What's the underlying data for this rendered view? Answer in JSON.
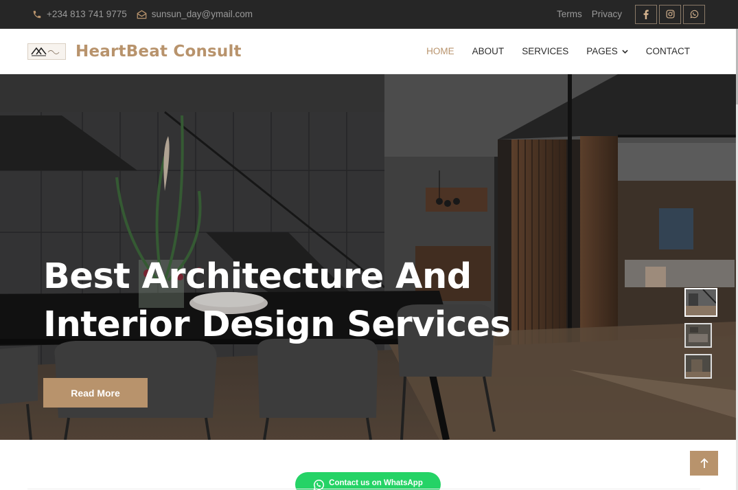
{
  "topbar": {
    "phone": "+234 813 741 9775",
    "email": "sunsun_day@ymail.com",
    "links": [
      "Terms",
      "Privacy"
    ],
    "socials": [
      "facebook-icon",
      "instagram-icon",
      "whatsapp-icon"
    ]
  },
  "navbar": {
    "brand": "HeartBeat Consult",
    "menu": [
      "HOME",
      "ABOUT",
      "SERVICES",
      "PAGES",
      "CONTACT"
    ],
    "active": "HOME"
  },
  "hero": {
    "title_line1": "Best Architecture And",
    "title_line2": "Interior Design Services",
    "cta": "Read More"
  },
  "whatsapp": {
    "label": "Contact us on WhatsApp"
  },
  "colors": {
    "accent": "#b8936c",
    "dark": "#262626",
    "whatsapp": "#25d366"
  }
}
